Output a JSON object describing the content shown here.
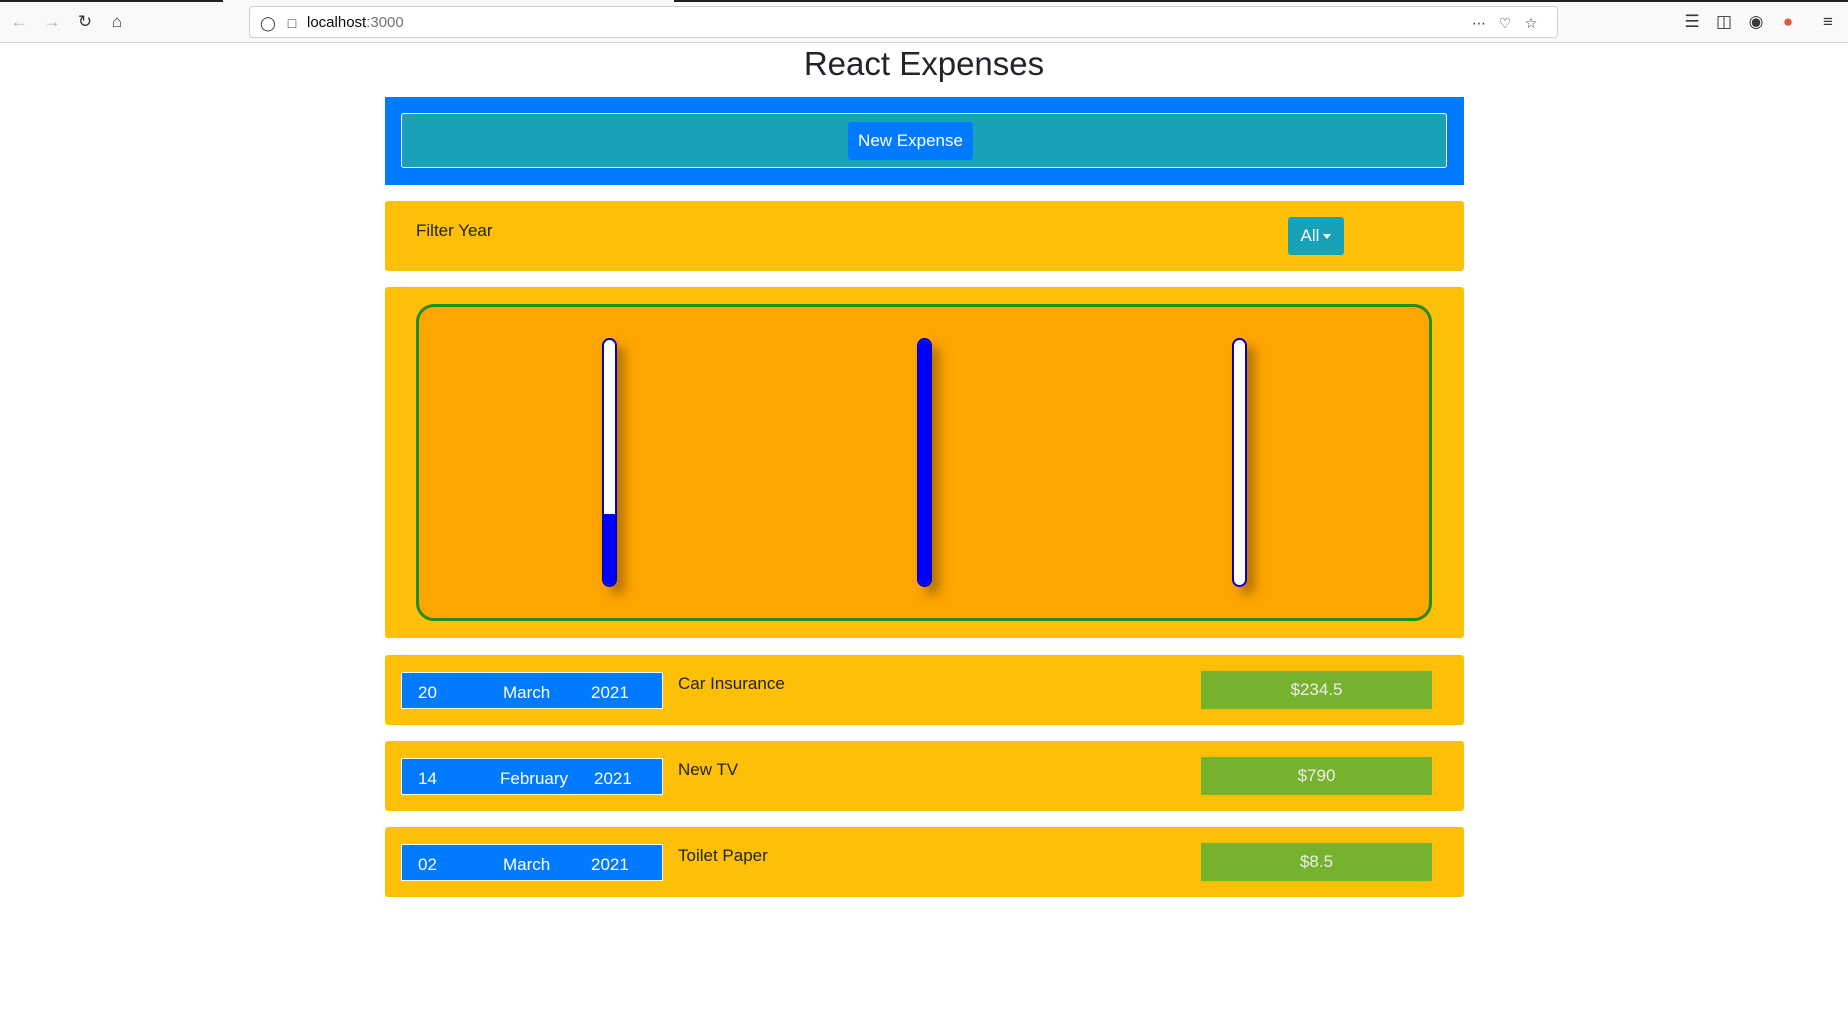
{
  "browser": {
    "url_host": "localhost",
    "url_port": ":3000"
  },
  "app": {
    "title": "React Expenses",
    "new_expense_label": "New Expense"
  },
  "filter": {
    "label": "Filter Year",
    "selected": "All"
  },
  "chart_data": {
    "type": "bar",
    "bars": [
      {
        "fill_fraction": 0.29
      },
      {
        "fill_fraction": 1.0
      },
      {
        "fill_fraction": 0.0
      }
    ],
    "fill_color": "#0000ff",
    "track_color": "#ffffff"
  },
  "expenses": [
    {
      "day": "20",
      "month": "March",
      "year": "2021",
      "title": "Car Insurance",
      "amount": "$234.5"
    },
    {
      "day": "14",
      "month": "February",
      "year": "2021",
      "title": "New TV",
      "amount": "$790"
    },
    {
      "day": "02",
      "month": "March",
      "year": "2021",
      "title": "Toilet Paper",
      "amount": "$8.5"
    }
  ],
  "colors": {
    "primary": "#007bff",
    "info": "#17a2b8",
    "warning": "#fec006",
    "chart_bg": "#ffa500",
    "chart_border": "#228b22",
    "amount_bg": "#77b22e"
  }
}
